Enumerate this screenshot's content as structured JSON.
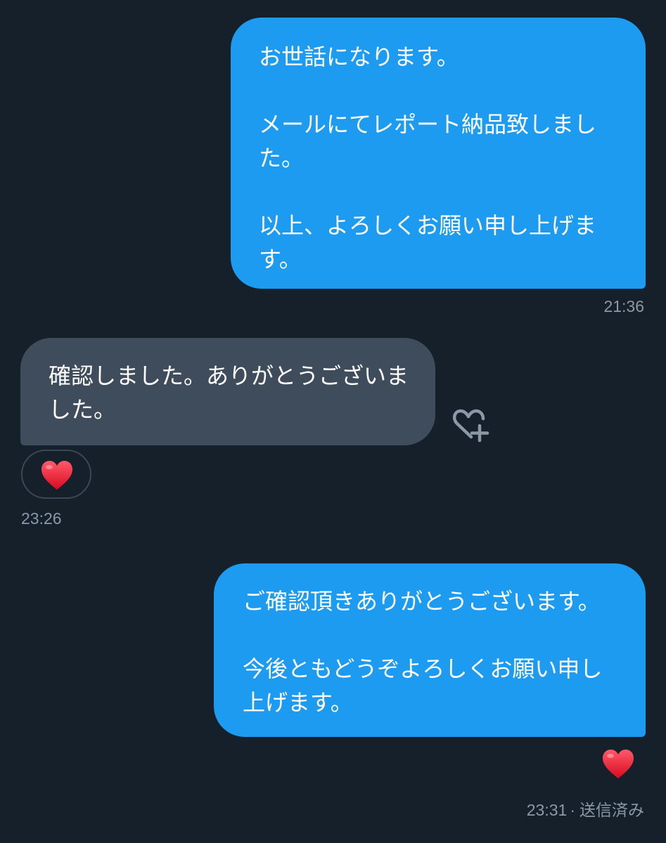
{
  "messages": [
    {
      "direction": "outgoing",
      "text": "お世話になります。\n\nメールにてレポート納品致しました。\n\n以上、よろしくお願い申し上げます。",
      "time": "21:36"
    },
    {
      "direction": "incoming",
      "text": "確認しました。ありがとうございました。",
      "time": "23:26",
      "reaction": "heart"
    },
    {
      "direction": "outgoing",
      "text": "ご確認頂きありがとうございます。\n\n今後ともどうぞよろしくお願い申し上げます。",
      "time": "23:31",
      "status": "送信済み",
      "reaction": "heart"
    }
  ],
  "separator": "·",
  "icons": {
    "add_reaction": "heart-plus-icon",
    "reaction": "red-heart-icon"
  },
  "colors": {
    "background": "#15202b",
    "outgoing_bubble": "#1d9bf0",
    "incoming_bubble": "#3f4c5c",
    "heart": "#f0142f",
    "meta_text": "#8b98a5"
  }
}
